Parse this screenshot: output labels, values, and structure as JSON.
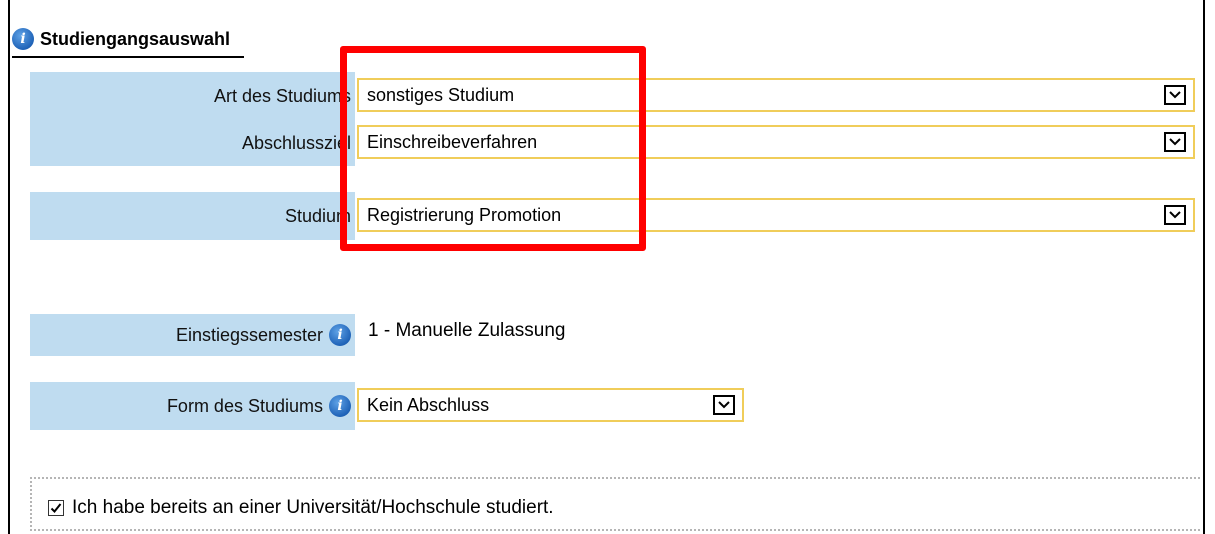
{
  "section": {
    "title": "Studiengangsauswahl",
    "icon": "info-icon"
  },
  "fields": {
    "art": {
      "label": "Art des Studiums",
      "value": "sonstiges Studium"
    },
    "abschluss": {
      "label": "Abschlussziel",
      "value": "Einschreibeverfahren"
    },
    "studium": {
      "label": "Studium",
      "value": "Registrierung Promotion"
    },
    "einstieg": {
      "label": "Einstiegssemester",
      "value": "1 - Manuelle Zulassung"
    },
    "form": {
      "label": "Form des Studiums",
      "value": "Kein Abschluss"
    }
  },
  "checkbox": {
    "label": "Ich habe bereits an einer Universität/Hochschule studiert.",
    "checked": true
  },
  "colors": {
    "label_bg": "#bfdcf0",
    "select_border": "#f0cd5a",
    "highlight": "#ff0000",
    "info_icon": "#1f63b8"
  }
}
